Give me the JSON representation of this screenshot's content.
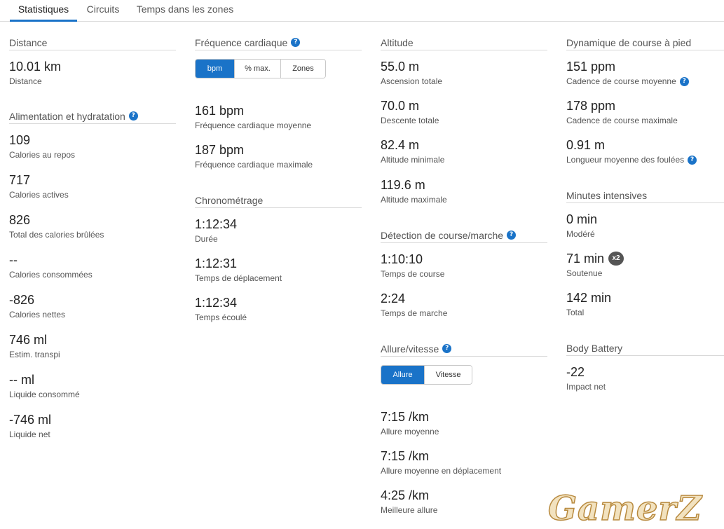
{
  "tabs": [
    "Statistiques",
    "Circuits",
    "Temps dans les zones"
  ],
  "colors": {
    "accent": "#1a73c8",
    "badge": "#555555"
  },
  "distance": {
    "title": "Distance",
    "items": [
      {
        "value": "10.01 km",
        "label": "Distance"
      }
    ]
  },
  "nutrition": {
    "title": "Alimentation et hydratation",
    "items": [
      {
        "value": "109",
        "label": "Calories au repos"
      },
      {
        "value": "717",
        "label": "Calories actives"
      },
      {
        "value": "826",
        "label": "Total des calories brûlées"
      },
      {
        "value": "--",
        "label": "Calories consommées"
      },
      {
        "value": "-826",
        "label": "Calories nettes"
      },
      {
        "value": "746 ml",
        "label": "Estim. transpi"
      },
      {
        "value": "-- ml",
        "label": "Liquide consommé"
      },
      {
        "value": "-746 ml",
        "label": "Liquide net"
      }
    ]
  },
  "heart_rate": {
    "title": "Fréquence cardiaque",
    "options": [
      "bpm",
      "% max.",
      "Zones"
    ],
    "selected": "bpm",
    "items": [
      {
        "value": "161 bpm",
        "label": "Fréquence cardiaque moyenne"
      },
      {
        "value": "187 bpm",
        "label": "Fréquence cardiaque maximale"
      }
    ]
  },
  "timing": {
    "title": "Chronométrage",
    "items": [
      {
        "value": "1:12:34",
        "label": "Durée"
      },
      {
        "value": "1:12:31",
        "label": "Temps de déplacement"
      },
      {
        "value": "1:12:34",
        "label": "Temps écoulé"
      }
    ]
  },
  "altitude": {
    "title": "Altitude",
    "items": [
      {
        "value": "55.0 m",
        "label": "Ascension totale"
      },
      {
        "value": "70.0 m",
        "label": "Descente totale"
      },
      {
        "value": "82.4 m",
        "label": "Altitude minimale"
      },
      {
        "value": "119.6 m",
        "label": "Altitude maximale"
      }
    ]
  },
  "run_walk": {
    "title": "Détection de course/marche",
    "items": [
      {
        "value": "1:10:10",
        "label": "Temps de course"
      },
      {
        "value": "2:24",
        "label": "Temps de marche"
      }
    ]
  },
  "pace": {
    "title": "Allure/vitesse",
    "options": [
      "Allure",
      "Vitesse"
    ],
    "selected": "Allure",
    "items": [
      {
        "value": "7:15 /km",
        "label": "Allure moyenne"
      },
      {
        "value": "7:15 /km",
        "label": "Allure moyenne en déplacement"
      },
      {
        "value": "4:25 /km",
        "label": "Meilleure allure"
      }
    ]
  },
  "running_dynamics": {
    "title": "Dynamique de course à pied",
    "items": [
      {
        "value": "151 ppm",
        "label": "Cadence de course moyenne"
      },
      {
        "value": "178 ppm",
        "label": "Cadence de course maximale"
      },
      {
        "value": "0.91 m",
        "label": "Longueur moyenne des foulées"
      }
    ]
  },
  "intensity": {
    "title": "Minutes intensives",
    "items": [
      {
        "value": "0 min",
        "label": "Modéré"
      },
      {
        "value": "71 min",
        "label": "Soutenue",
        "badge": "x2"
      },
      {
        "value": "142 min",
        "label": "Total"
      }
    ]
  },
  "body_battery": {
    "title": "Body Battery",
    "items": [
      {
        "value": "-22",
        "label": "Impact net"
      }
    ]
  },
  "watermark": "GamerZ"
}
